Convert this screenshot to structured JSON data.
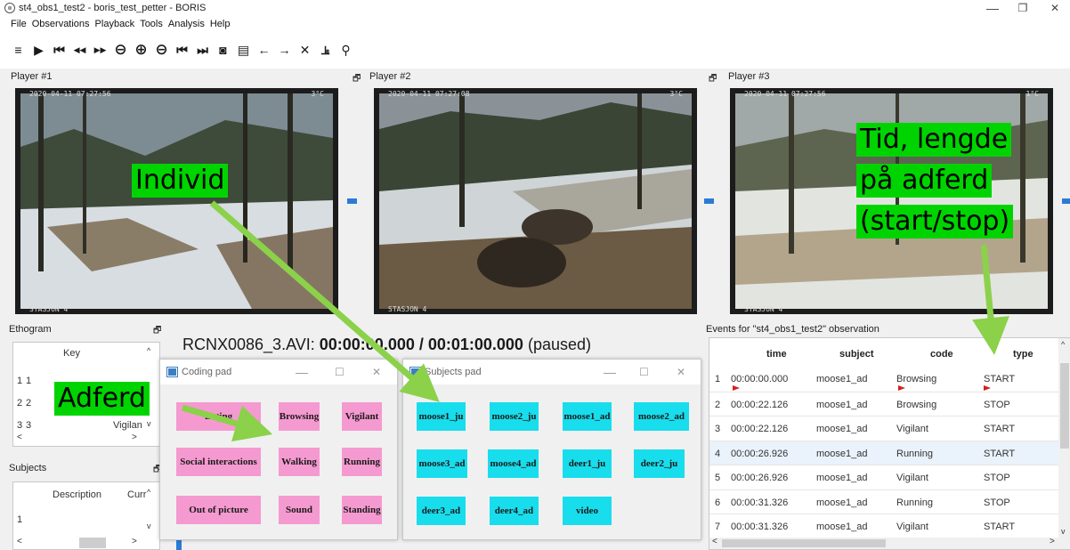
{
  "window": {
    "title": "st4_obs1_test2 - boris_test_petter - BORIS",
    "minimize": "—",
    "maximize": "❐",
    "close": "✕"
  },
  "menu": [
    "File",
    "Observations",
    "Playback",
    "Tools",
    "Analysis",
    "Help"
  ],
  "toolbar": {
    "icons": [
      "list-icon",
      "play-icon",
      "skip-start-icon",
      "rewind-icon",
      "fast-forward-icon",
      "minus-circle-icon",
      "plus-circle-icon",
      "minus-circle-icon",
      "previous-media-icon",
      "next-media-icon",
      "camera-icon",
      "frame-icon",
      "arrow-left-icon",
      "arrow-right-icon",
      "close-icon",
      "chart-icon",
      "search-icon"
    ],
    "glyphs": [
      "≡",
      "▶",
      "⏮",
      "◀◀",
      "▶▶",
      "⊖",
      "⊕",
      "⊖",
      "⏮",
      "⏭",
      "◙",
      "▤",
      "←",
      "→",
      "✕",
      "⫡",
      "⚲"
    ]
  },
  "players": [
    {
      "label": "Player #1",
      "timestamp": "2020-04-11 07:27:56",
      "station": "STASJON 4",
      "temp": "3°C"
    },
    {
      "label": "Player #2",
      "timestamp": "2020-04-11 07:27:08",
      "station": "STASJON 4",
      "temp": "3°C"
    },
    {
      "label": "Player #3",
      "timestamp": "2020-04-11 07:27:56",
      "station": "STASJON 4",
      "temp": "1°C"
    }
  ],
  "ethogram": {
    "title": "Ethogram",
    "col_key": "Key",
    "rows": [
      {
        "num": "1",
        "key": "1",
        "code": ""
      },
      {
        "num": "2",
        "key": "2",
        "code": ""
      },
      {
        "num": "3",
        "key": "3",
        "code": "Vigilan"
      }
    ]
  },
  "subjects": {
    "title": "Subjects",
    "col_desc": "Description",
    "col_curr": "Curr",
    "rows": [
      {
        "num": "1"
      }
    ]
  },
  "file_status": {
    "filename": "RCNX0086_3.AVI:",
    "time": "00:00:00.000 / 00:01:00.000",
    "state": "(paused)"
  },
  "coding_pad": {
    "title": "Coding pad",
    "buttons": [
      "Eating",
      "Browsing",
      "Vigilant",
      "Social interactions",
      "Walking",
      "Running",
      "Out of picture",
      "Sound",
      "Standing"
    ]
  },
  "subjects_pad": {
    "title": "Subjects pad",
    "buttons": [
      "moose1_ju",
      "moose2_ju",
      "moose1_ad",
      "moose2_ad",
      "moose3_ad",
      "moose4_ad",
      "deer1_ju",
      "deer2_ju",
      "deer3_ad",
      "deer4_ad",
      "video"
    ]
  },
  "events": {
    "title": "Events for \"st4_obs1_test2\" observation",
    "columns": [
      "time",
      "subject",
      "code",
      "type"
    ],
    "rows": [
      {
        "n": "1",
        "time": "00:00:00.000",
        "subject": "moose1_ad",
        "code": "Browsing",
        "type": "START"
      },
      {
        "n": "2",
        "time": "00:00:22.126",
        "subject": "moose1_ad",
        "code": "Browsing",
        "type": "STOP"
      },
      {
        "n": "3",
        "time": "00:00:22.126",
        "subject": "moose1_ad",
        "code": "Vigilant",
        "type": "START"
      },
      {
        "n": "4",
        "time": "00:00:26.926",
        "subject": "moose1_ad",
        "code": "Running",
        "type": "START"
      },
      {
        "n": "5",
        "time": "00:00:26.926",
        "subject": "moose1_ad",
        "code": "Vigilant",
        "type": "STOP"
      },
      {
        "n": "6",
        "time": "00:00:31.326",
        "subject": "moose1_ad",
        "code": "Running",
        "type": "STOP"
      },
      {
        "n": "7",
        "time": "00:00:31.326",
        "subject": "moose1_ad",
        "code": "Vigilant",
        "type": "START"
      }
    ]
  },
  "annotations": {
    "individ": "Individ",
    "adferd": "Adferd",
    "tid_line1": "Tid, lengde",
    "tid_line2": "på adferd",
    "tid_line3": "(start/stop)"
  },
  "colors": {
    "annotation_green": "#00d400",
    "arrow_green": "#8bd14a",
    "coding_pink": "#f59ad0",
    "subject_cyan": "#18ddec",
    "handle_blue": "#2b7bd4"
  }
}
